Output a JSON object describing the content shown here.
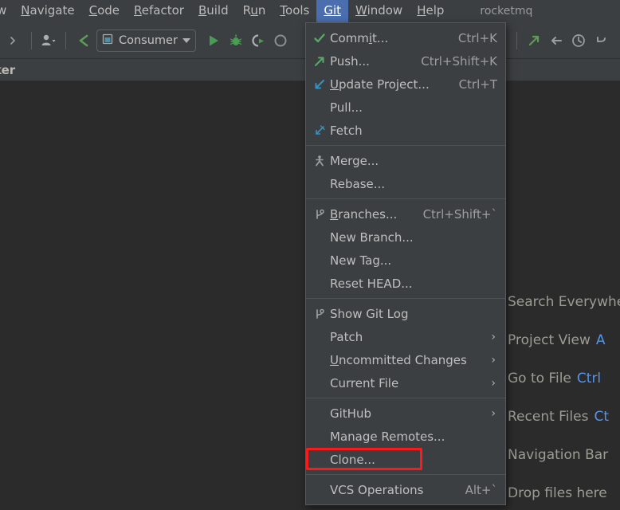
{
  "menubar": {
    "items": [
      {
        "label": "w",
        "mnemonic": "",
        "active": false,
        "truncated": true
      },
      {
        "label": "Navigate",
        "mnemonic": "N",
        "active": false
      },
      {
        "label": "Code",
        "mnemonic": "C",
        "active": false
      },
      {
        "label": "Refactor",
        "mnemonic": "R",
        "active": false
      },
      {
        "label": "Build",
        "mnemonic": "B",
        "active": false
      },
      {
        "label": "Run",
        "mnemonic": "u",
        "active": false
      },
      {
        "label": "Tools",
        "mnemonic": "T",
        "active": false
      },
      {
        "label": "Git",
        "mnemonic": "G",
        "active": true
      },
      {
        "label": "Window",
        "mnemonic": "W",
        "active": false
      },
      {
        "label": "Help",
        "mnemonic": "H",
        "active": false
      }
    ],
    "project_name": "rocketmq"
  },
  "toolbar": {
    "avatar_icon": "user-avatar-icon",
    "back_icon": "back-arrow-icon",
    "run_config": {
      "icon": "run-configuration-icon",
      "label": "Consumer",
      "dropdown_icon": "chevron-down-icon"
    },
    "run_icon": "run-play-icon",
    "debug_icon": "debug-bug-icon",
    "run_with_coverage_icon": "run-with-coverage-icon",
    "stop_icon": "stop-icon",
    "push_icon": "git-push-arrow-icon",
    "update_icon": "git-update-arrow-icon",
    "history_icon": "clock-history-icon",
    "undo_icon": "undo-arrow-icon"
  },
  "breadcrumb": {
    "text": "ker"
  },
  "git_menu": {
    "groups": [
      {
        "items": [
          {
            "label": "Commit...",
            "mnemonic": "i",
            "accel": "Ctrl+K",
            "icon": "green-check-icon",
            "submenu": false
          },
          {
            "label": "Push...",
            "mnemonic": "",
            "accel": "Ctrl+Shift+K",
            "icon": "green-up-right-arrow-icon",
            "submenu": false
          },
          {
            "label": "Update Project...",
            "mnemonic": "U",
            "accel": "Ctrl+T",
            "icon": "blue-down-left-arrow-icon",
            "submenu": false
          },
          {
            "label": "Pull...",
            "mnemonic": "",
            "accel": "",
            "icon": "",
            "submenu": false
          },
          {
            "label": "Fetch",
            "mnemonic": "",
            "accel": "",
            "icon": "blue-fetch-arrow-icon",
            "submenu": false
          }
        ]
      },
      {
        "items": [
          {
            "label": "Merge...",
            "mnemonic": "",
            "accel": "",
            "icon": "merge-icon",
            "submenu": false
          },
          {
            "label": "Rebase...",
            "mnemonic": "",
            "accel": "",
            "icon": "",
            "submenu": false
          }
        ]
      },
      {
        "items": [
          {
            "label": "Branches...",
            "mnemonic": "B",
            "accel": "Ctrl+Shift+`",
            "icon": "branch-icon",
            "submenu": false
          },
          {
            "label": "New Branch...",
            "mnemonic": "",
            "accel": "",
            "icon": "",
            "submenu": false
          },
          {
            "label": "New Tag...",
            "mnemonic": "",
            "accel": "",
            "icon": "",
            "submenu": false
          },
          {
            "label": "Reset HEAD...",
            "mnemonic": "",
            "accel": "",
            "icon": "",
            "submenu": false
          }
        ]
      },
      {
        "items": [
          {
            "label": "Show Git Log",
            "mnemonic": "",
            "accel": "",
            "icon": "branch-icon",
            "submenu": false
          },
          {
            "label": "Patch",
            "mnemonic": "",
            "accel": "",
            "icon": "",
            "submenu": true
          },
          {
            "label": "Uncommitted Changes",
            "mnemonic": "U",
            "accel": "",
            "icon": "",
            "submenu": true
          },
          {
            "label": "Current File",
            "mnemonic": "",
            "accel": "",
            "icon": "",
            "submenu": true
          }
        ]
      },
      {
        "items": [
          {
            "label": "GitHub",
            "mnemonic": "",
            "accel": "",
            "icon": "",
            "submenu": true
          },
          {
            "label": "Manage Remotes...",
            "mnemonic": "",
            "accel": "",
            "icon": "",
            "submenu": false
          },
          {
            "label": "Clone...",
            "mnemonic": "",
            "accel": "",
            "icon": "",
            "submenu": false,
            "highlighted": true
          }
        ]
      },
      {
        "items": [
          {
            "label": "VCS Operations",
            "mnemonic": "",
            "accel": "Alt+`",
            "icon": "",
            "submenu": false
          }
        ]
      }
    ],
    "highlight_color": "#ff1a1a"
  },
  "editor_hints": [
    {
      "label": "Search Everywhere",
      "shortcut": ""
    },
    {
      "label": "Project View",
      "shortcut": "A"
    },
    {
      "label": "Go to File",
      "shortcut": "Ctrl"
    },
    {
      "label": "Recent Files",
      "shortcut": "Ct"
    },
    {
      "label": "Navigation Bar",
      "shortcut": ""
    },
    {
      "label": "Drop files here",
      "shortcut": ""
    }
  ],
  "colors": {
    "chrome": "#3c3f41",
    "editor": "#2b2b2b",
    "accent_blue": "#4b6eaf",
    "shortcut_blue": "#5394ec",
    "text": "#bfbfbf",
    "highlight_red": "#ff1a1a"
  }
}
